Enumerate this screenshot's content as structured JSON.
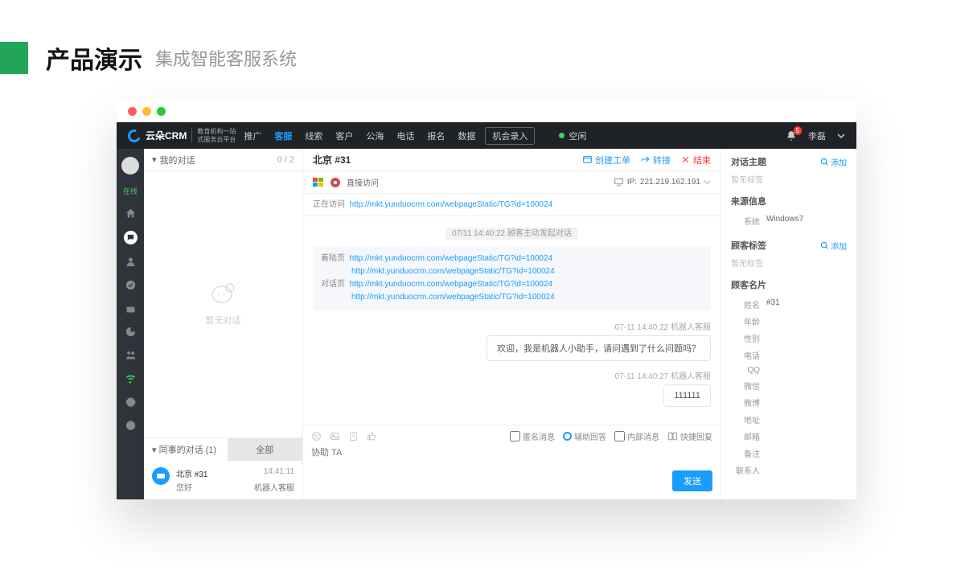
{
  "slide": {
    "title": "产品演示",
    "subtitle": "集成智能客服系统"
  },
  "nav": {
    "brand": "云朵CRM",
    "brandSubL1": "教育机构一站",
    "brandSubL2": "式服务云平台",
    "items": [
      "推广",
      "客服",
      "线索",
      "客户",
      "公海",
      "电话",
      "报名",
      "数据"
    ],
    "activeIndex": 1,
    "recordBtn": "机会录入",
    "status": "空闲",
    "badge": "5",
    "user": "李磊"
  },
  "iconbar": {
    "statusLabel": "在线"
  },
  "left": {
    "myConvTitle": "我的对话",
    "myConvCount": "0 / 2",
    "emptyText": "暂无对话",
    "colleagueTab": "同事的对话  (1)",
    "allTab": "全部",
    "conv": {
      "name": "北京 #31",
      "preview": "您好",
      "time": "14:41:11",
      "agent": "机器人客服"
    }
  },
  "mid": {
    "title": "北京 #31",
    "actions": {
      "ticket": "创建工单",
      "transfer": "转接",
      "end": "结束"
    },
    "directVisit": "直接访问",
    "ipLabel": "IP:",
    "ipValue": "221.219.162.191",
    "visitingLabel": "正在访问",
    "visitingUrl": "http://mkt.yunduocrm.com/webpageStatic/TG?id=100024",
    "centerMeta": "07/11 14:40:22  顾客主动发起对话",
    "landingLabel": "着陆页",
    "dialogLabel": "对话页",
    "landingUrl1": "http://mkt.yunduocrm.com/webpageStatic/TG?id=100024",
    "landingUrl2": "http://mkt.yunduocrm.com/webpageStatic/TG?id=100024",
    "dialogUrl1": "http://mkt.yunduocrm.com/webpageStatic/TG?id=100024",
    "dialogUrl2": "http://mkt.yunduocrm.com/webpageStatic/TG?id=100024",
    "msg1": {
      "time": "07-11 14:40:22  机器人客服",
      "text": "欢迎，我是机器人小助手，请问遇到了什么问题吗？"
    },
    "msg2": {
      "time": "07-11 14:40:27  机器人客服",
      "text": "111111"
    },
    "composePlaceholder": "协助 TA",
    "anonLabel": "匿名消息",
    "assistLabel": "辅助回答",
    "internalLabel": "内部消息",
    "quickLabel": "快捷回复",
    "sendBtn": "发送"
  },
  "right": {
    "topicTitle": "对话主题",
    "addLabel": "添加",
    "noTag": "暂无标签",
    "sourceTitle": "来源信息",
    "systemKey": "系统",
    "systemVal": "Windows7",
    "tagTitle": "顾客标签",
    "cardTitle": "顾客名片",
    "card": {
      "nameK": "姓名",
      "nameV": "#31",
      "ageK": "年龄",
      "sexK": "性别",
      "phoneK": "电话",
      "qqK": "QQ",
      "wechatK": "微信",
      "weiboK": "微博",
      "addrK": "地址",
      "emailK": "邮箱",
      "remarkK": "备注",
      "contactK": "联系人"
    }
  }
}
